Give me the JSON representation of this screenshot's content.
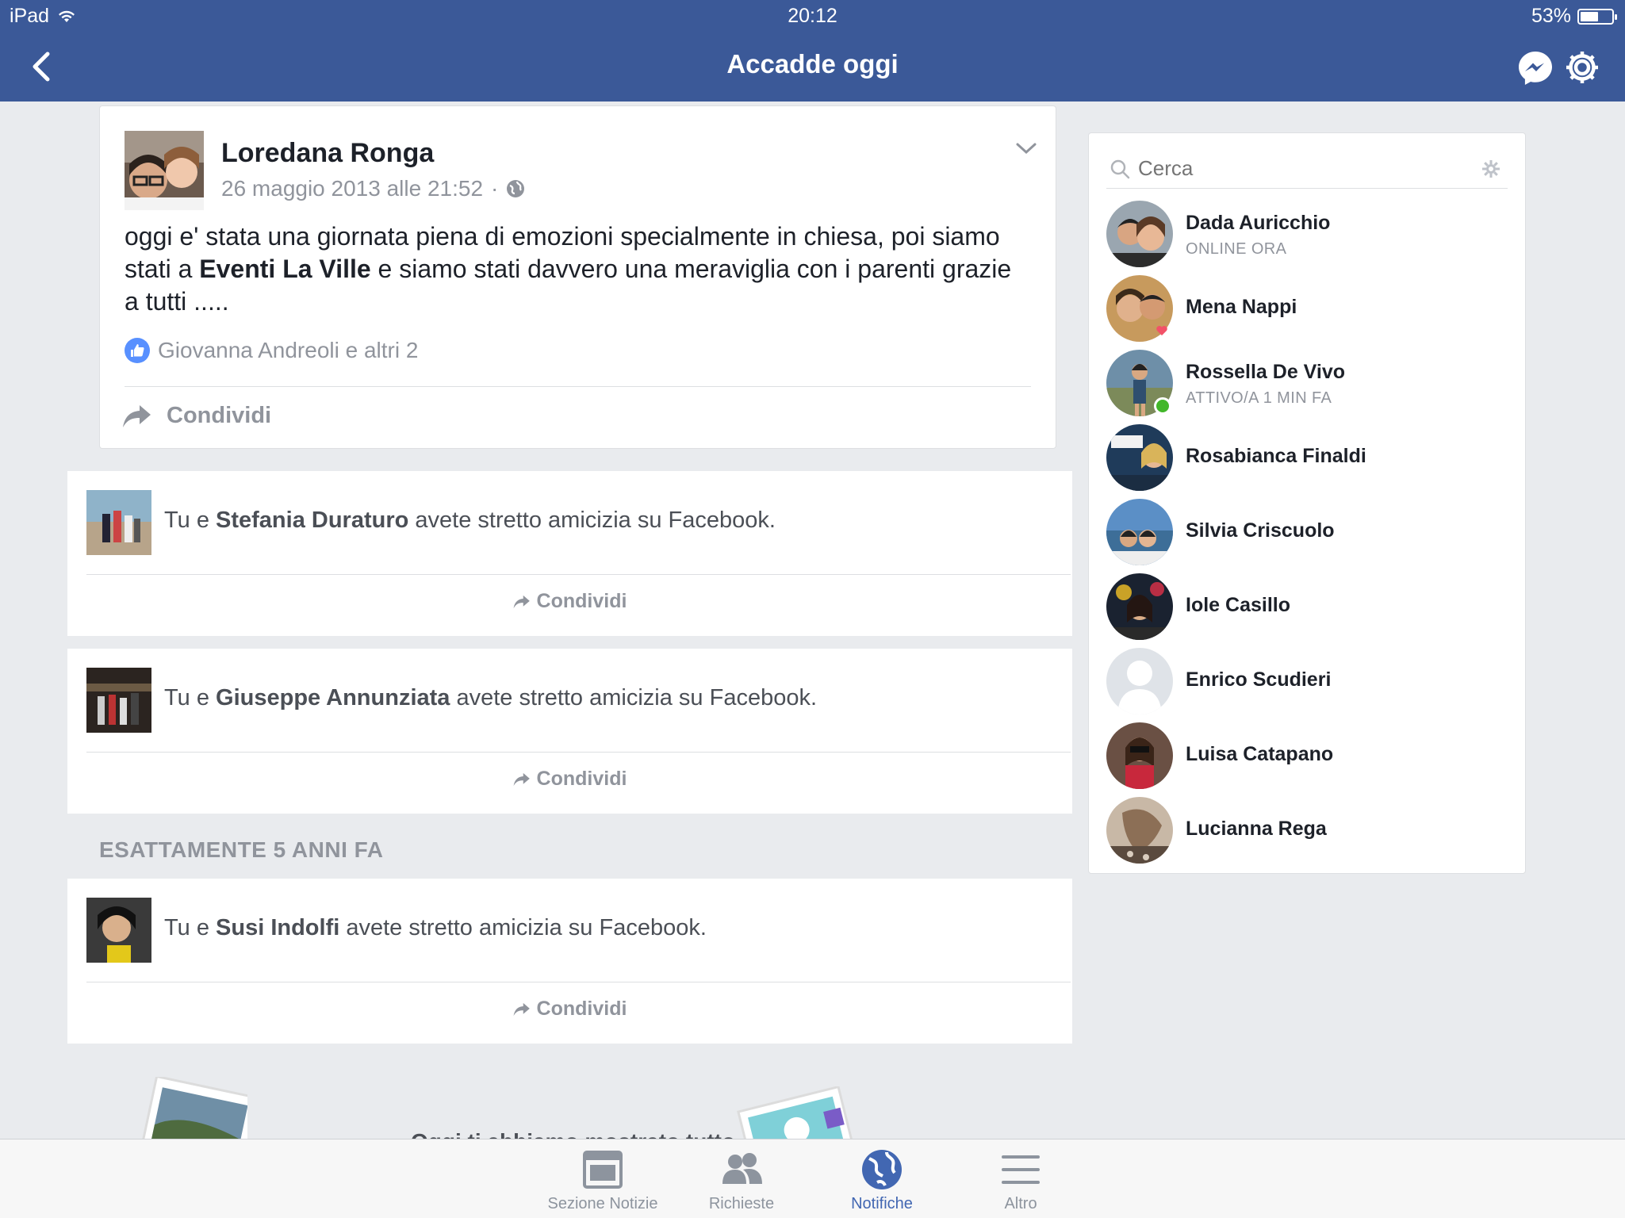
{
  "status_bar": {
    "device": "iPad",
    "time": "20:12",
    "battery": "53%"
  },
  "nav": {
    "title": "Accadde oggi"
  },
  "memory_post": {
    "author": "Loredana Ronga",
    "date": "26 maggio 2013 alle 21:52",
    "separator": "·",
    "text_before": "oggi e' stata una giornata piena di emozioni specialmente in chiesa, poi siamo stati a ",
    "text_bold": "Eventi La Ville",
    "text_after": " e siamo stati davvero una meraviglia con i parenti  grazie a tutti .....",
    "likes": "Giovanna Andreoli e altri 2",
    "share_label": "Condividi"
  },
  "friendships": [
    {
      "prefix": "Tu e ",
      "name": "Stefania Duraturo",
      "suffix": " avete stretto amicizia su Facebook.",
      "share_label": "Condividi"
    },
    {
      "prefix": "Tu e ",
      "name": "Giuseppe Annunziata",
      "suffix": " avete stretto amicizia su Facebook.",
      "share_label": "Condividi"
    },
    {
      "prefix": "Tu e ",
      "name": "Susi Indolfi",
      "suffix": " avete stretto amicizia su Facebook.",
      "share_label": "Condividi"
    }
  ],
  "section_heading": "ESATTAMENTE 5 ANNI FA",
  "bottom_peek_text": "Oggi ti abbiamo mostrato tutto",
  "sidebar": {
    "search_placeholder": "Cerca",
    "contacts": [
      {
        "name": "Dada Auricchio",
        "status": "ONLINE ORA"
      },
      {
        "name": "Mena Nappi",
        "status": ""
      },
      {
        "name": "Rossella De Vivo",
        "status": "ATTIVO/A 1 MIN FA"
      },
      {
        "name": "Rosabianca Finaldi",
        "status": ""
      },
      {
        "name": "Silvia Criscuolo",
        "status": ""
      },
      {
        "name": "Iole Casillo",
        "status": ""
      },
      {
        "name": "Enrico Scudieri",
        "status": ""
      },
      {
        "name": "Luisa Catapano",
        "status": ""
      },
      {
        "name": "Lucianna Rega",
        "status": ""
      }
    ]
  },
  "tabs": [
    {
      "label": "Sezione Notizie",
      "icon": "news-feed-icon",
      "active": false
    },
    {
      "label": "Richieste",
      "icon": "friend-requests-icon",
      "active": false
    },
    {
      "label": "Notifiche",
      "icon": "globe-icon",
      "active": true
    },
    {
      "label": "Altro",
      "icon": "menu-icon",
      "active": false
    }
  ],
  "colors": {
    "brand": "#3b5998",
    "active_tab": "#4267b2",
    "online": "#42b72a",
    "like": "#5890ff"
  }
}
